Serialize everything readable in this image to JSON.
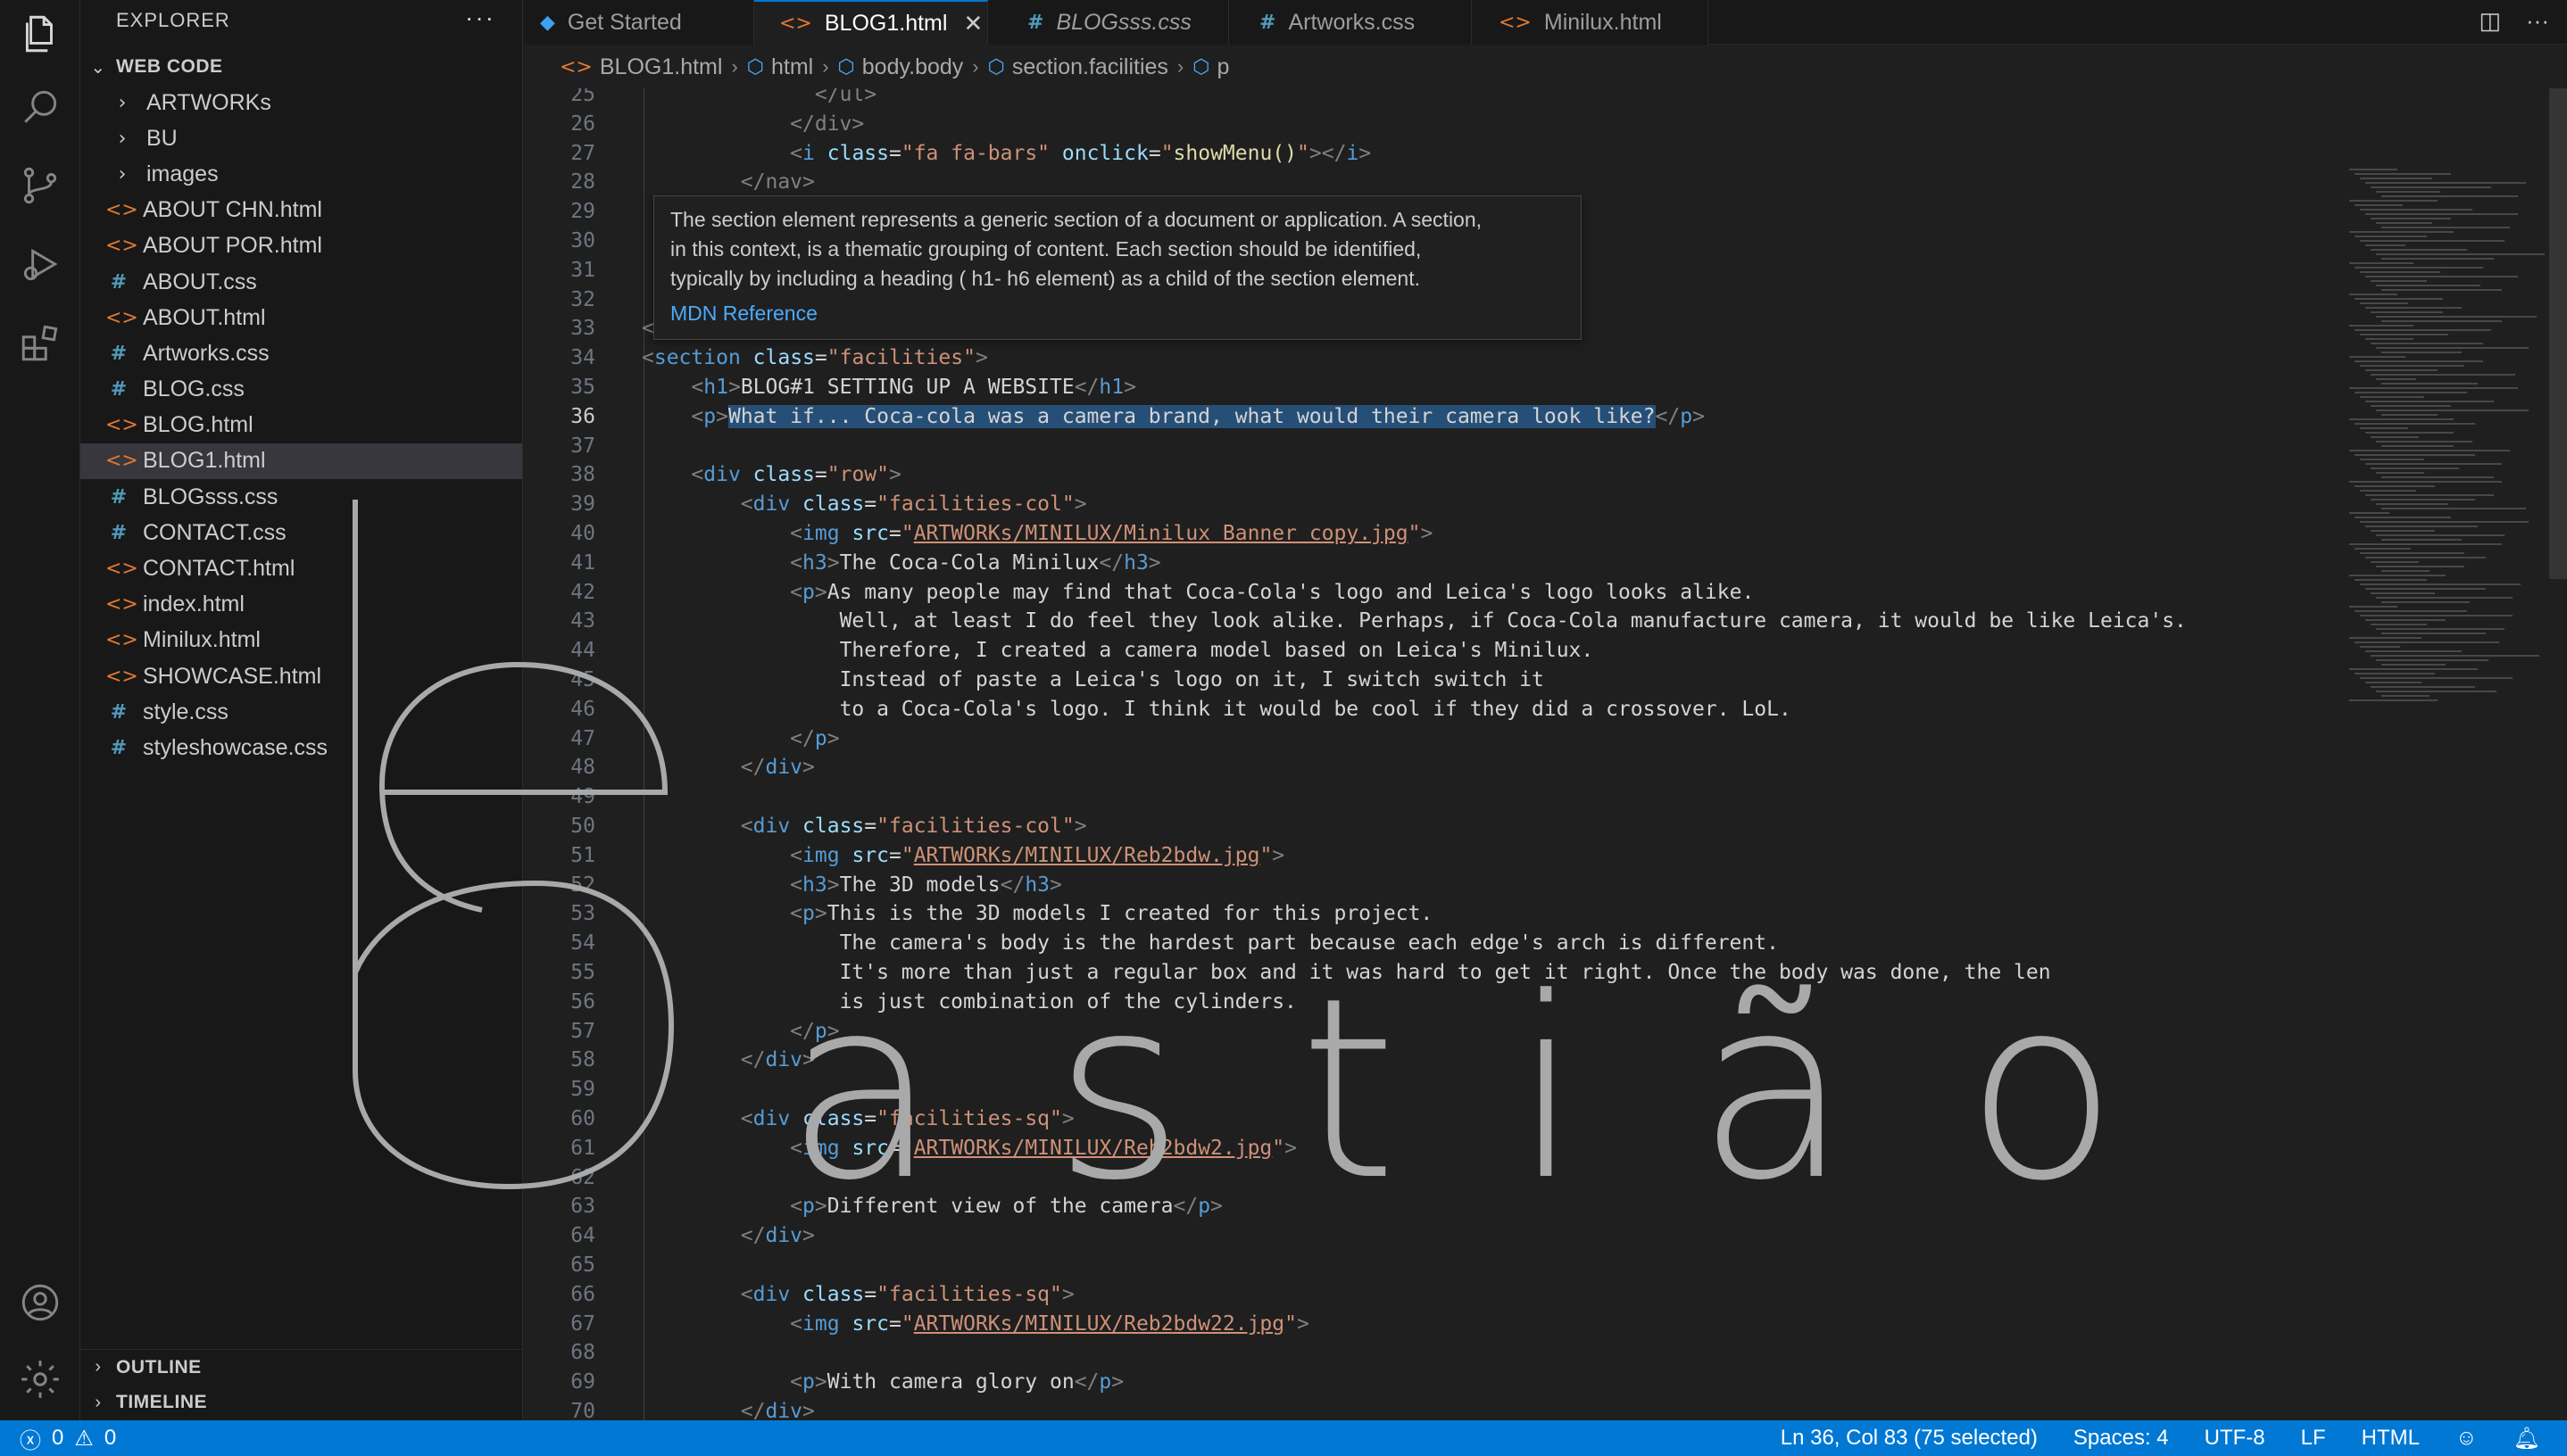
{
  "sidebar": {
    "title": "EXPLORER",
    "more": "···",
    "workspace": "WEB CODE",
    "items": [
      {
        "type": "folder",
        "label": "ARTWORKs"
      },
      {
        "type": "folder",
        "label": "BU"
      },
      {
        "type": "folder",
        "label": "images"
      },
      {
        "type": "html",
        "label": "ABOUT CHN.html"
      },
      {
        "type": "html",
        "label": "ABOUT POR.html"
      },
      {
        "type": "css",
        "label": "ABOUT.css"
      },
      {
        "type": "html",
        "label": "ABOUT.html"
      },
      {
        "type": "css",
        "label": "Artworks.css"
      },
      {
        "type": "css",
        "label": "BLOG.css"
      },
      {
        "type": "html",
        "label": "BLOG.html"
      },
      {
        "type": "html",
        "label": "BLOG1.html",
        "selected": true
      },
      {
        "type": "css",
        "label": "BLOGsss.css"
      },
      {
        "type": "css",
        "label": "CONTACT.css"
      },
      {
        "type": "html",
        "label": "CONTACT.html"
      },
      {
        "type": "html",
        "label": "index.html"
      },
      {
        "type": "html",
        "label": "Minilux.html"
      },
      {
        "type": "html",
        "label": "SHOWCASE.html"
      },
      {
        "type": "css",
        "label": "style.css"
      },
      {
        "type": "css",
        "label": "styleshowcase.css"
      }
    ],
    "outline": "OUTLINE",
    "timeline": "TIMELINE"
  },
  "tabs": [
    {
      "label": "Get Started",
      "icon": "vscode-icon"
    },
    {
      "label": "BLOG1.html",
      "icon": "html-icon",
      "active": true
    },
    {
      "label": "BLOGsss.css",
      "icon": "css-icon",
      "italic": true
    },
    {
      "label": "Artworks.css",
      "icon": "css-icon"
    },
    {
      "label": "Minilux.html",
      "icon": "html-icon"
    }
  ],
  "breadcrumb": [
    "BLOG1.html",
    "html",
    "body.body",
    "section.facilities",
    "p"
  ],
  "hover": {
    "line1": "The section element represents a generic section of a document or application. A section,",
    "line2": "in this context, is a thematic grouping of content. Each section should be identified,",
    "line3": "typically by including a heading ( h1- h6 element) as a child of the section element.",
    "ref": "MDN Reference"
  },
  "editor": {
    "line_numbers": [
      "25",
      "26",
      "27",
      "28",
      "29",
      "30",
      "31",
      "32",
      "33",
      "34",
      "35",
      "36",
      "37",
      "38",
      "39",
      "40",
      "41",
      "42",
      "43",
      "44",
      "45",
      "46",
      "47",
      "48",
      "49",
      "50",
      "51",
      "52",
      "53",
      "54",
      "55",
      "56",
      "57",
      "58",
      "59",
      "60",
      "61",
      "62",
      "63",
      "64",
      "65",
      "66",
      "67",
      "68",
      "69",
      "70"
    ],
    "current_line": "36",
    "code": {
      "l25": "</ul>",
      "l26": "</div>",
      "l27_attr_val": "\"fa fa-bars\"",
      "l27_fn": "showMenu()",
      "l28": "</nav>",
      "l34_class": "\"facilities\"",
      "l35_text": "BLOG#1 SETTING UP A WEBSITE",
      "l36_text": "What if... Coca-cola was a camera brand, what would their camera look like?",
      "l38_class": "\"row\"",
      "l39_class": "\"facilities-col\"",
      "l40_src": "ARTWORKs/MINILUX/Minilux Banner copy.jpg",
      "l41_text": "The Coca-Cola Minilux",
      "l42_text": "As many people may find that Coca-Cola's logo and Leica's logo looks alike.",
      "l43_text": "Well, at least I do feel they look alike. Perhaps, if Coca-Cola manufacture camera, it would be like Leica's.",
      "l44_text": "Therefore, I created a camera model based on Leica's Minilux.",
      "l45_text": "Instead of paste a Leica's logo on it, I switch switch it",
      "l46_text": "to a Coca-Cola's logo. I think it would be cool if they did a crossover. LoL.",
      "l50_class": "\"facilities-col\"",
      "l51_src": "ARTWORKs/MINILUX/Reb2bdw.jpg",
      "l52_text": "The 3D models",
      "l53_text": "This is the 3D models I created for this project.",
      "l54_text": "The camera's body is the hardest part because each edge's arch is different.",
      "l55_text": "It's more than just a regular box and it was hard to get it right. Once the body was done, the len",
      "l56_text": "is just combination of the cylinders.",
      "l60_class": "\"facilities-sq\"",
      "l61_src": "ARTWORKs/MINILUX/Reb2bdw2.jpg",
      "l63_text": "Different view of the camera",
      "l66_class": "\"facilities-sq\"",
      "l67_src": "ARTWORKs/MINILUX/Reb2bdw22.jpg",
      "l69_text": "With camera glory on"
    }
  },
  "watermark": {
    "big_letters": "b",
    "word": "a s t i ã o"
  },
  "statusbar": {
    "errors": "0",
    "warnings": "0",
    "position": "Ln 36, Col 83 (75 selected)",
    "spaces": "Spaces: 4",
    "encoding": "UTF-8",
    "eol": "LF",
    "language": "HTML"
  },
  "colors": {
    "accent": "#0078d4",
    "html_icon": "#e37933",
    "css_icon": "#519aba"
  }
}
